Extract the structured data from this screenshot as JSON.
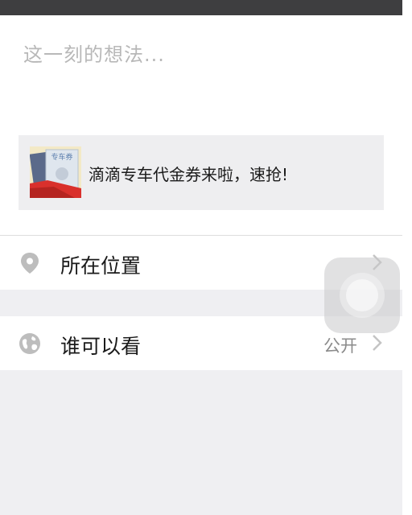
{
  "compose": {
    "placeholder": "这一刻的想法..."
  },
  "share_card": {
    "text": "滴滴专车代金券来啦，速抢!",
    "thumbnail_caption": "专车券",
    "thumbnail_icon": "didi-coupon-thumbnail"
  },
  "options": {
    "location": {
      "label": "所在位置",
      "icon": "location-pin-icon"
    },
    "visibility": {
      "label": "谁可以看",
      "value": "公开",
      "icon": "globe-icon"
    }
  },
  "colors": {
    "status_bar": "#3e3e40",
    "placeholder": "#b8b8b8",
    "card_bg": "#eeeef0",
    "background": "#efeff2",
    "icon_gray": "#bdbdbd",
    "coupon_red": "#d9302c"
  }
}
